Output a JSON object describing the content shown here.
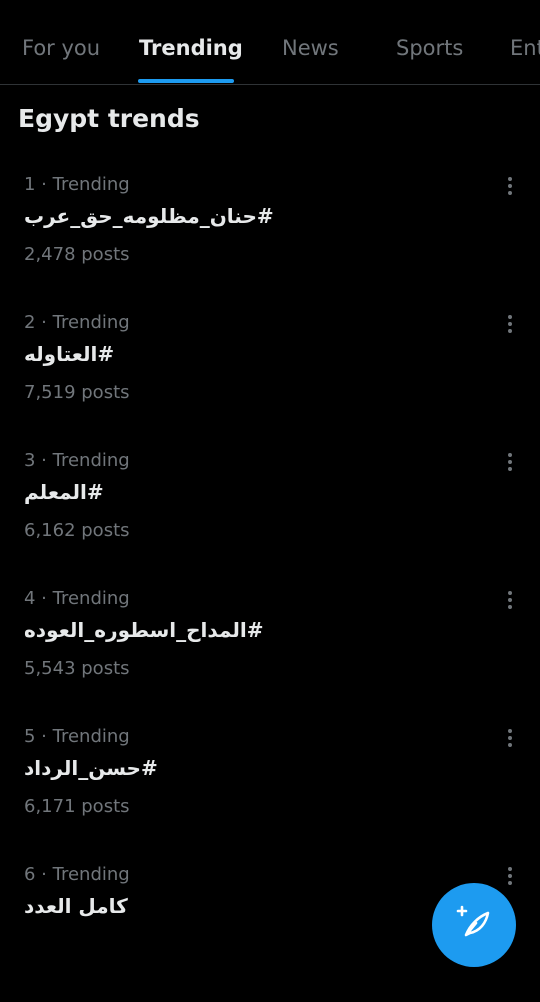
{
  "tabs": [
    {
      "label": "For you"
    },
    {
      "label": "Trending"
    },
    {
      "label": "News"
    },
    {
      "label": "Sports"
    },
    {
      "label": "Ent"
    }
  ],
  "section_title": "Egypt trends",
  "trends": [
    {
      "meta": "1 · Trending",
      "name": "#حنان_مظلومه_حق_عرب",
      "count": "2,478 posts"
    },
    {
      "meta": "2 · Trending",
      "name": "#العتاوله",
      "count": "7,519 posts"
    },
    {
      "meta": "3 · Trending",
      "name": "#المعلم",
      "count": "6,162 posts"
    },
    {
      "meta": "4 · Trending",
      "name": "#المداح_اسطوره_العوده",
      "count": "5,543 posts"
    },
    {
      "meta": "5 · Trending",
      "name": "#حسن_الرداد",
      "count": "6,171 posts"
    },
    {
      "meta": "6 · Trending",
      "name": "كامل العدد",
      "count": ""
    }
  ],
  "icons": {
    "more": "more-vertical-icon",
    "compose": "compose-post-icon"
  },
  "colors": {
    "accent": "#1d9bf0",
    "background": "#000000",
    "muted": "#71767b",
    "text": "#e7e9ea"
  }
}
